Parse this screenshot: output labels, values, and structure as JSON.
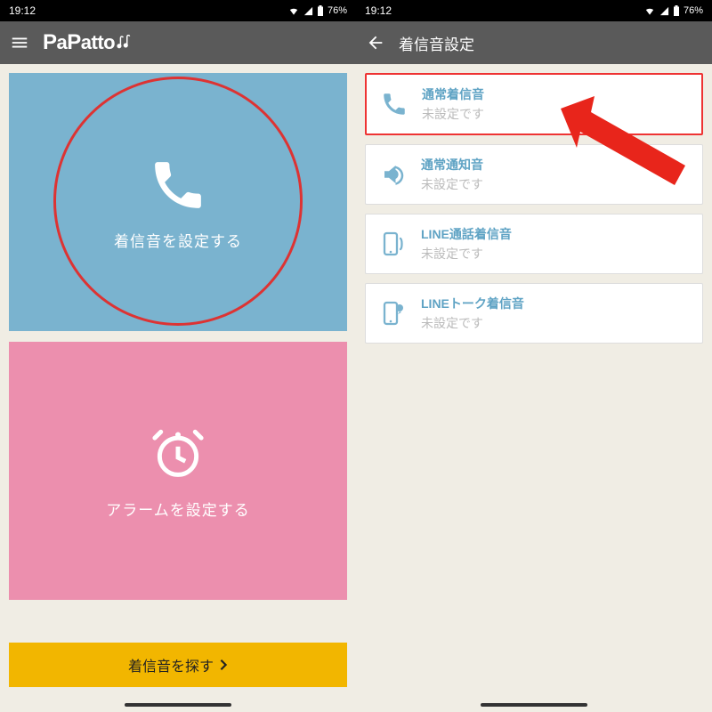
{
  "status": {
    "time": "19:12",
    "battery": "76%"
  },
  "left": {
    "logo_text": "PaPatto",
    "card_ring": {
      "label": "着信音を設定する"
    },
    "card_alarm": {
      "label": "アラームを設定する"
    },
    "search_btn": "着信音を探す"
  },
  "right": {
    "title": "着信音設定",
    "rows": [
      {
        "title": "通常着信音",
        "sub": "未設定です",
        "icon": "phone"
      },
      {
        "title": "通常通知音",
        "sub": "未設定です",
        "icon": "speaker"
      },
      {
        "title": "LINE通話着信音",
        "sub": "未設定です",
        "icon": "phone-ring"
      },
      {
        "title": "LINEトーク着信音",
        "sub": "未設定です",
        "icon": "phone-chat"
      }
    ]
  }
}
